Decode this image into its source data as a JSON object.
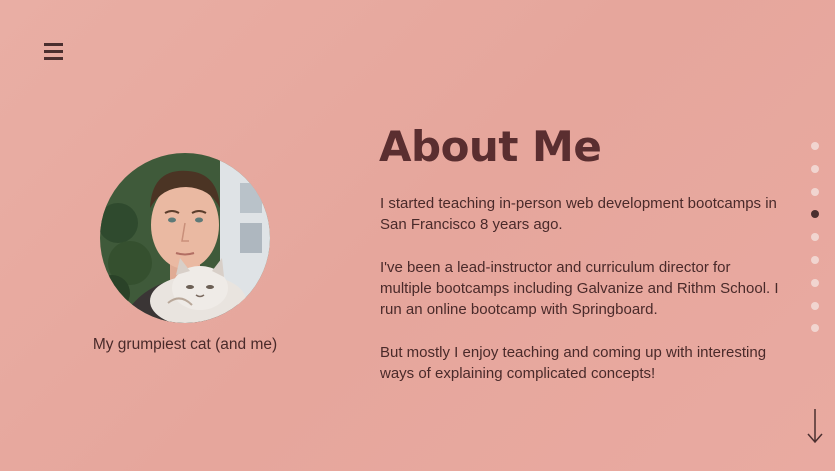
{
  "nav": {
    "menu_icon": "hamburger-menu-icon"
  },
  "profile": {
    "photo": "profile-photo-with-cat",
    "caption": "My grumpiest cat (and me)"
  },
  "about": {
    "title": "About Me",
    "paragraphs": [
      "I started teaching in-person web development bootcamps in San Francisco 8 years ago.",
      "I've been a lead-instructor and curriculum director for multiple bootcamps including Galvanize and Rithm School.  I run an online bootcamp with Springboard.",
      "But mostly I enjoy teaching and coming up with interesting ways of explaining complicated concepts!"
    ]
  },
  "section_nav": {
    "count": 9,
    "active_index": 3
  },
  "scroll": {
    "icon": "arrow-down-icon"
  },
  "colors": {
    "background": "#e8aaa0",
    "heading": "#5a2e30",
    "text": "#4a2a2a",
    "dot_inactive": "#f1d5d0",
    "dot_active": "#4a2f2f"
  }
}
